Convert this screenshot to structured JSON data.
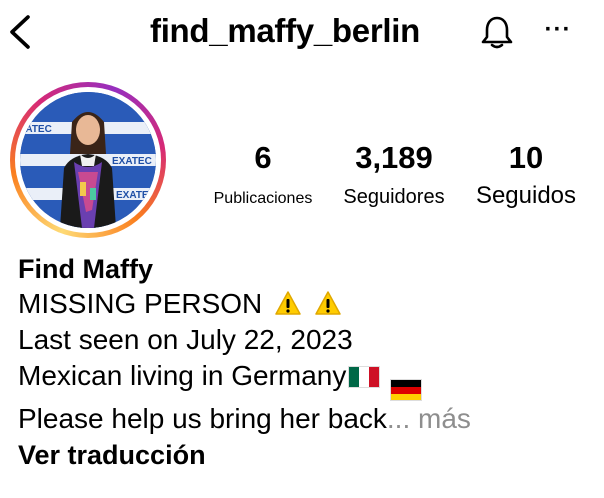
{
  "header": {
    "username": "find_maffy_berlin",
    "back_icon": "chevron-left-icon",
    "bell_icon": "bell-icon",
    "more_icon": "more-horizontal-icon",
    "more_glyph": "···"
  },
  "avatar": {
    "ring_colors": [
      "#feda75",
      "#fa7e1e",
      "#d62976",
      "#962fbf"
    ],
    "backdrop_text": "EXATEC"
  },
  "stats": {
    "posts": {
      "value": "6",
      "label": "Publicaciones"
    },
    "followers": {
      "value": "3,189",
      "label": "Seguidores"
    },
    "following": {
      "value": "10",
      "label": "Seguidos"
    }
  },
  "bio": {
    "name": "Find Maffy",
    "line1": "MISSING PERSON",
    "line2": "Last seen on July 22, 2023",
    "line3": "Mexican living in Germany",
    "line4": "Please help us bring her back",
    "ellipsis": "...",
    "more_label": "más",
    "translate_label": "Ver traducción"
  },
  "colors": {
    "muted": "#8e8e8e",
    "warning_yellow": "#ffcc00"
  }
}
